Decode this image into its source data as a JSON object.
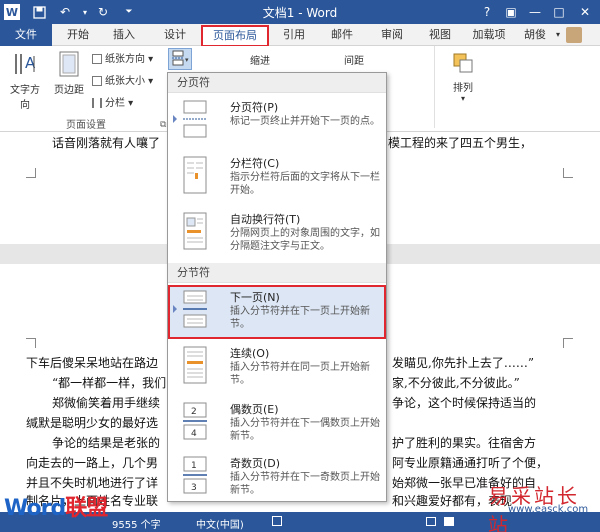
{
  "window": {
    "title": "文档1 - Word",
    "controls": [
      "?",
      "▣",
      "—",
      "□",
      "✕"
    ]
  },
  "qat": {
    "icons": [
      "word-icon",
      "save-icon",
      "undo-icon",
      "redo-icon",
      "customize-icon"
    ]
  },
  "tabs": {
    "file": "文件",
    "items": [
      "开始",
      "插入",
      "设计",
      "页面布局",
      "引用",
      "邮件",
      "审阅",
      "视图",
      "加载项"
    ],
    "active": "页面布局",
    "user": "胡俊"
  },
  "ribbon": {
    "text_direction": "文字方向",
    "margins": "页边距",
    "orientation": "纸张方向",
    "size": "纸张大小",
    "columns": "分栏",
    "indent": "缩进",
    "spacing": "间距",
    "arrange": "排列",
    "group_page_setup": "页面设置"
  },
  "dropdown": {
    "section1": "分页符",
    "section2": "分节符",
    "items": [
      {
        "title": "分页符(P)",
        "desc": "标记一页终止并开始下一页的点。"
      },
      {
        "title": "分栏符(C)",
        "desc": "指示分栏符后面的文字将从下一栏开始。"
      },
      {
        "title": "自动换行符(T)",
        "desc": "分隔网页上的对象周围的文字，如分隔题注文字与正文。"
      },
      {
        "title": "下一页(N)",
        "desc": "插入分节符并在下一页上开始新节。"
      },
      {
        "title": "连续(O)",
        "desc": "插入分节符并在同一页上开始新节。"
      },
      {
        "title": "偶数页(E)",
        "desc": "插入分节符并在下一偶数页上开始新节。"
      },
      {
        "title": "奇数页(D)",
        "desc": "插入分节符并在下一奇数页上开始新节。"
      }
    ]
  },
  "doc": {
    "line_top_left": "话音刚落就有人嚷了",
    "line_top_right": "模工程的来了四五个男生，",
    "lines_left": [
      "下车后傻呆呆地站在路边",
      "“都一样都一样，我们",
      "郑微偷笑着用手继续",
      "缄默是聪明少女的最好选",
      "争论的结果是老张的",
      "向走去的一路上，几个男",
      "并且不失时机地进行了详",
      "制名片，上面姓名专业联"
    ],
    "lines_right": [
      "发瞄见,你先扑上去了……”",
      "家,不分彼此,不分彼此。”",
      "争论，这个时候保持适当的",
      "护了胜利的果实。往宿舍方",
      "阿专业原籍通通打听了个便，",
      "始郑微一张早已准备好的自",
      "和兴趣爱好都有，表现"
    ]
  },
  "status": {
    "words": "9555 个字",
    "language": "中文(中国)"
  },
  "watermark": {
    "brand_left_1": "Word",
    "brand_left_2": "联盟",
    "brand_right": "易采站长站",
    "brand_right_url": "www.easck.com"
  }
}
